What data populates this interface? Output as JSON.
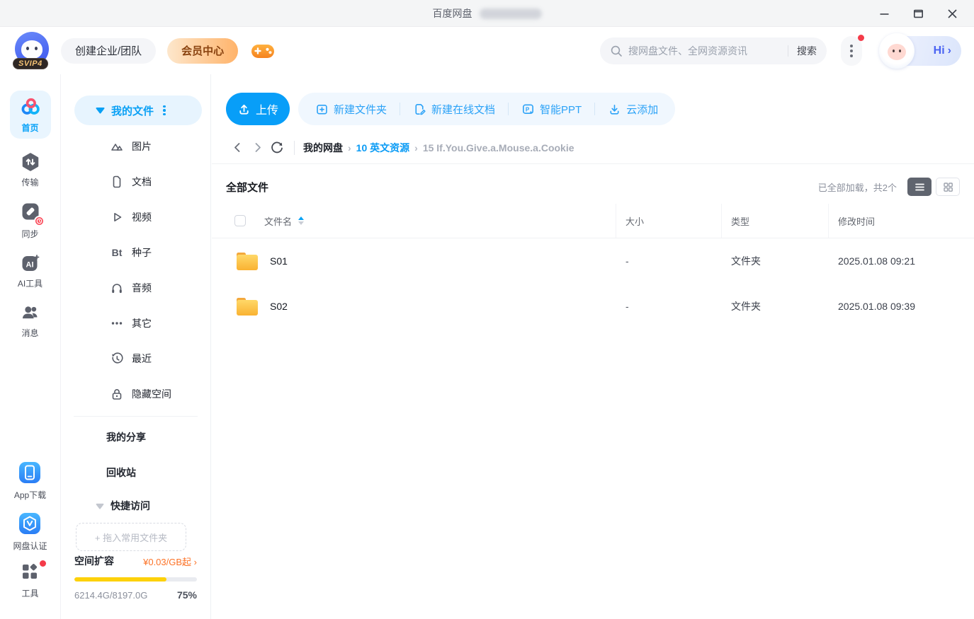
{
  "titlebar": {
    "title": "百度网盘"
  },
  "header": {
    "logo_badge": "SVIP4",
    "create_team": "创建企业/团队",
    "vip_center": "会员中心",
    "search_placeholder": "搜网盘文件、全网资源资讯",
    "search_button": "搜索",
    "greeting": "Hi"
  },
  "left_rail": {
    "items": [
      {
        "label": "首页",
        "active": true
      },
      {
        "label": "传输"
      },
      {
        "label": "同步"
      },
      {
        "label": "AI工具",
        "icon_text": "AI"
      },
      {
        "label": "消息"
      }
    ],
    "bottom_items": [
      {
        "label": "App下载"
      },
      {
        "label": "网盘认证"
      },
      {
        "label": "工具"
      }
    ]
  },
  "sidebar": {
    "my_files": "我的文件",
    "categories": [
      {
        "label": "图片"
      },
      {
        "label": "文档"
      },
      {
        "label": "视频"
      },
      {
        "label": "种子",
        "icon_text": "Bt"
      },
      {
        "label": "音频"
      },
      {
        "label": "其它"
      },
      {
        "label": "最近"
      },
      {
        "label": "隐藏空间"
      }
    ],
    "links": [
      {
        "label": "我的分享"
      },
      {
        "label": "回收站"
      }
    ],
    "quick_access": "快捷访问",
    "drop_hint": "+ 拖入常用文件夹",
    "storage": {
      "label": "空间扩容",
      "price": "¥0.03/GB起",
      "usage": "6214.4G/8197.0G",
      "percent": "75%"
    }
  },
  "toolbar": {
    "upload": "上传",
    "actions": [
      {
        "label": "新建文件夹"
      },
      {
        "label": "新建在线文档"
      },
      {
        "label": "智能PPT",
        "icon_text": "P"
      },
      {
        "label": "云添加"
      }
    ]
  },
  "breadcrumb": {
    "items": [
      {
        "label": "我的网盘"
      },
      {
        "label": "10 英文资源"
      },
      {
        "label": "15 If.You.Give.a.Mouse.a.Cookie"
      }
    ]
  },
  "filelist": {
    "title": "全部文件",
    "load_status": "已全部加载，共2个",
    "columns": [
      {
        "label": "文件名"
      },
      {
        "label": "大小"
      },
      {
        "label": "类型"
      },
      {
        "label": "修改时间"
      }
    ],
    "rows": [
      {
        "name": "S01",
        "size": "-",
        "type": "文件夹",
        "modified": "2025.01.08 09:21"
      },
      {
        "name": "S02",
        "size": "-",
        "type": "文件夹",
        "modified": "2025.01.08 09:39"
      }
    ]
  },
  "icons": {
    "search": "⌕",
    "menu_dots": "⋮",
    "dropdown_caret": "▼",
    "chevron_right": "›",
    "back": "‹",
    "forward": "›",
    "refresh": "⟳",
    "sort": "▲▼",
    "upload": "↥",
    "new_folder": "▣+",
    "new_doc": "✎",
    "cloud_add": "⤓",
    "list_view": "☰",
    "grid_view": "▦",
    "folder": "🗀",
    "lock": "🔒",
    "clock_history": "🕘",
    "headphones": "🎧",
    "play": "▷",
    "document": "🗎",
    "photo": "△",
    "ellipsis": "•••",
    "people": "👥",
    "phone": "📱",
    "gamepad": "🎮",
    "minimize": "─",
    "maximize": "□",
    "close": "✕"
  },
  "colors": {
    "accent_blue": "#06a7ff",
    "vip_text": "#8a4310",
    "vip_gradient_start": "#fde7cc",
    "vip_gradient_end": "#ffb36a",
    "progress_yellow": "#fdd10a",
    "badge_red": "#f43b49",
    "folder_yellow": "#f9b232",
    "hi_blue": "#4a63f2"
  }
}
